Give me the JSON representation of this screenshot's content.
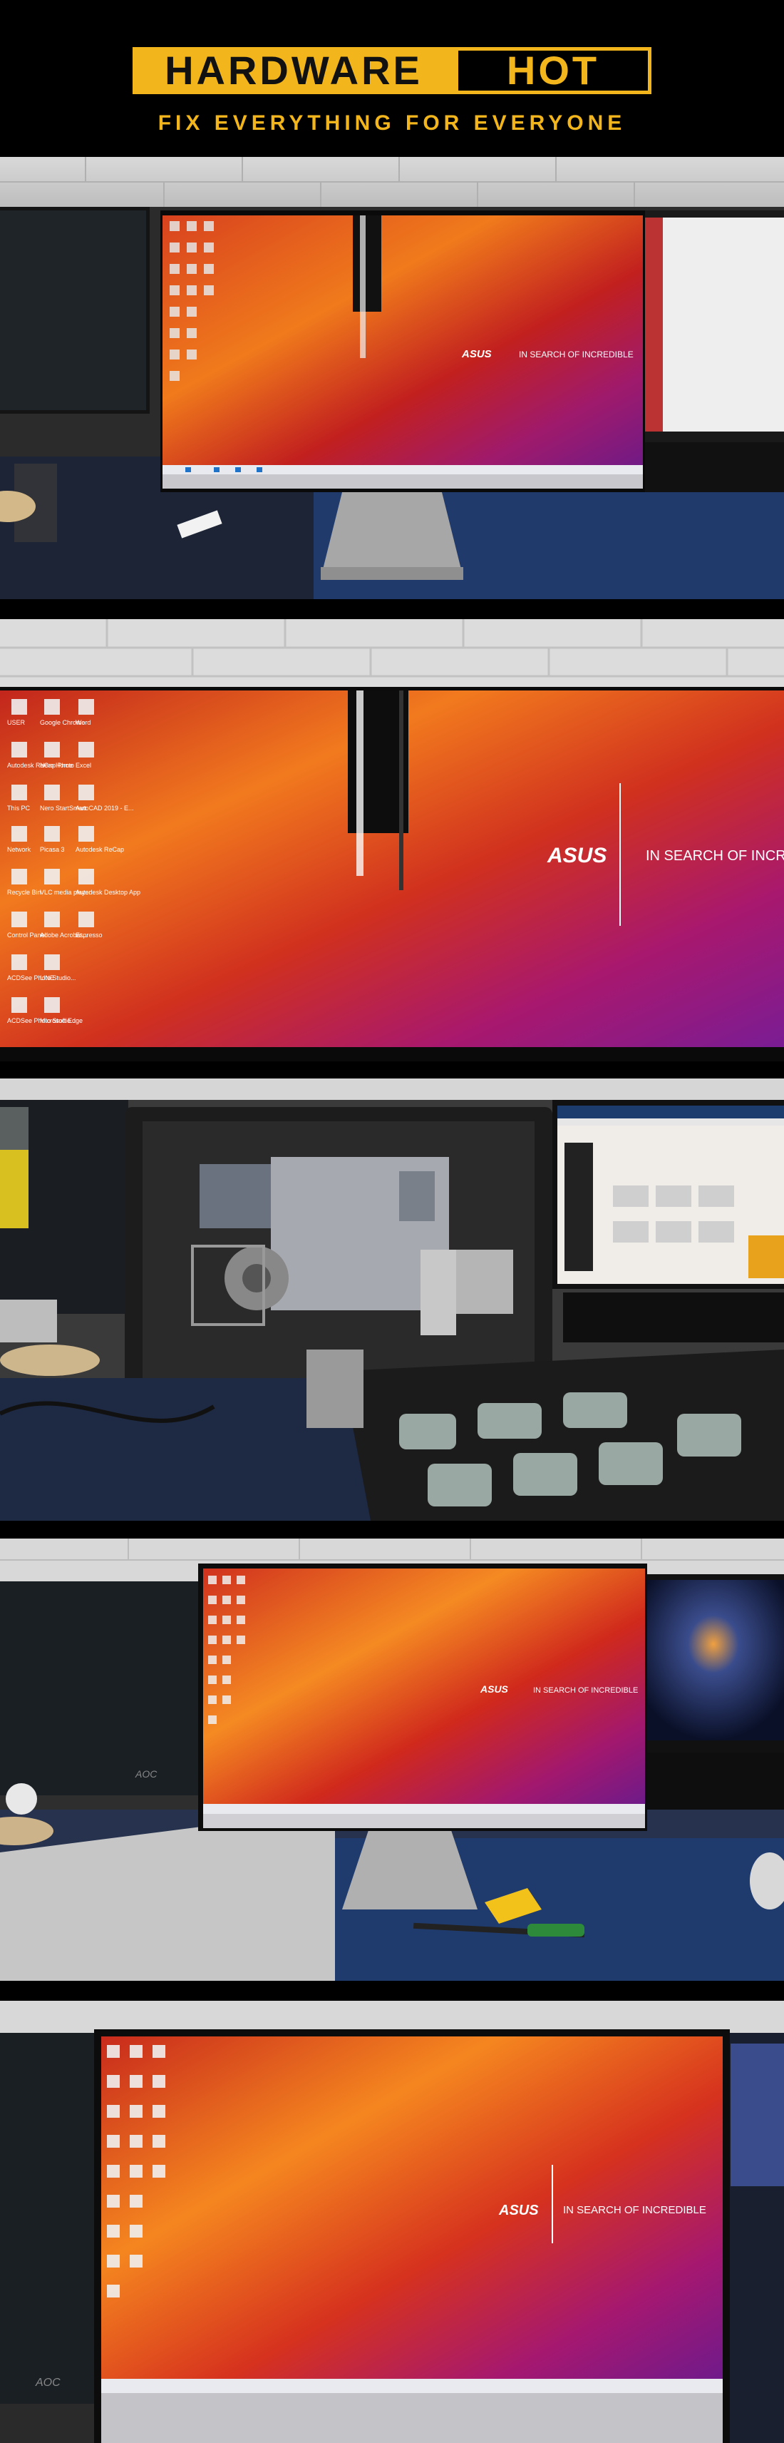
{
  "brand": {
    "name_part1": "HARDWARE",
    "name_part2": "HOT",
    "tagline": "FIX EVERYTHING FOR EVERYONE",
    "accent_color": "#f2b51b"
  },
  "wallpaper": {
    "brand_text": "ASUS",
    "slogan": "IN SEARCH OF INCREDIBLE"
  },
  "desktop_icons": [
    "USER",
    "Google Chrome",
    "Word",
    "Autodesk ReCap Photo",
    "Nero Home",
    "Excel",
    "This PC",
    "Nero StartSmart",
    "AutoCAD 2019 - E...",
    "Network",
    "Picasa 3",
    "Autodesk ReCap",
    "Recycle Bin",
    "VLC media player",
    "Autodesk Desktop App",
    "Control Panel",
    "Adobe Acrobat...",
    "Espresso",
    "ACDSee Photo Studio...",
    "LINE",
    "ACDSee Photo Studio...",
    "Microsoft Edge"
  ],
  "monitor_label": "AOC",
  "photos": [
    {
      "name": "photo-before-repair-desk"
    },
    {
      "name": "photo-before-repair-closeup"
    },
    {
      "name": "photo-disassembled-aio"
    },
    {
      "name": "photo-after-repair-desk"
    },
    {
      "name": "photo-after-repair-closeup"
    }
  ]
}
